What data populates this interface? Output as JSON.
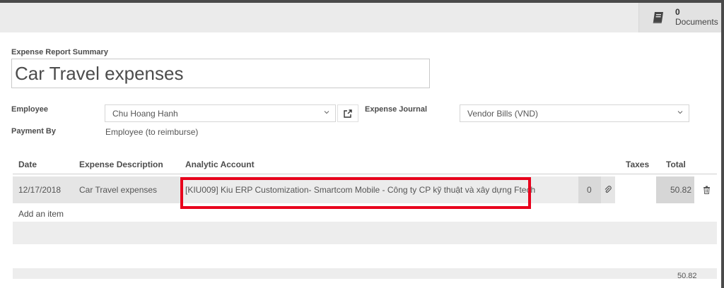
{
  "documents": {
    "count": "0",
    "label": "Documents",
    "icon": "book-icon"
  },
  "form": {
    "summary_label": "Expense Report Summary",
    "summary_value": "Car Travel expenses",
    "employee_label": "Employee",
    "employee_value": "Chu Hoang Hanh",
    "journal_label": "Expense Journal",
    "journal_value": "Vendor Bills (VND)",
    "payment_label": "Payment By",
    "payment_value": "Employee (to reimburse)"
  },
  "table": {
    "headers": {
      "date": "Date",
      "description": "Expense Description",
      "analytic": "Analytic Account",
      "taxes": "Taxes",
      "total": "Total"
    },
    "rows": [
      {
        "date": "12/17/2018",
        "description": "Car Travel expenses",
        "analytic": "[KIU009] Kiu ERP Customization- Smartcom Mobile - Công ty CP kỹ thuật và xây dựng Ftech",
        "quantity": "0",
        "total": "50.82"
      }
    ],
    "add_item": "Add an item",
    "footer_total": "50.82"
  },
  "colors": {
    "highlight": "#e8001c"
  }
}
